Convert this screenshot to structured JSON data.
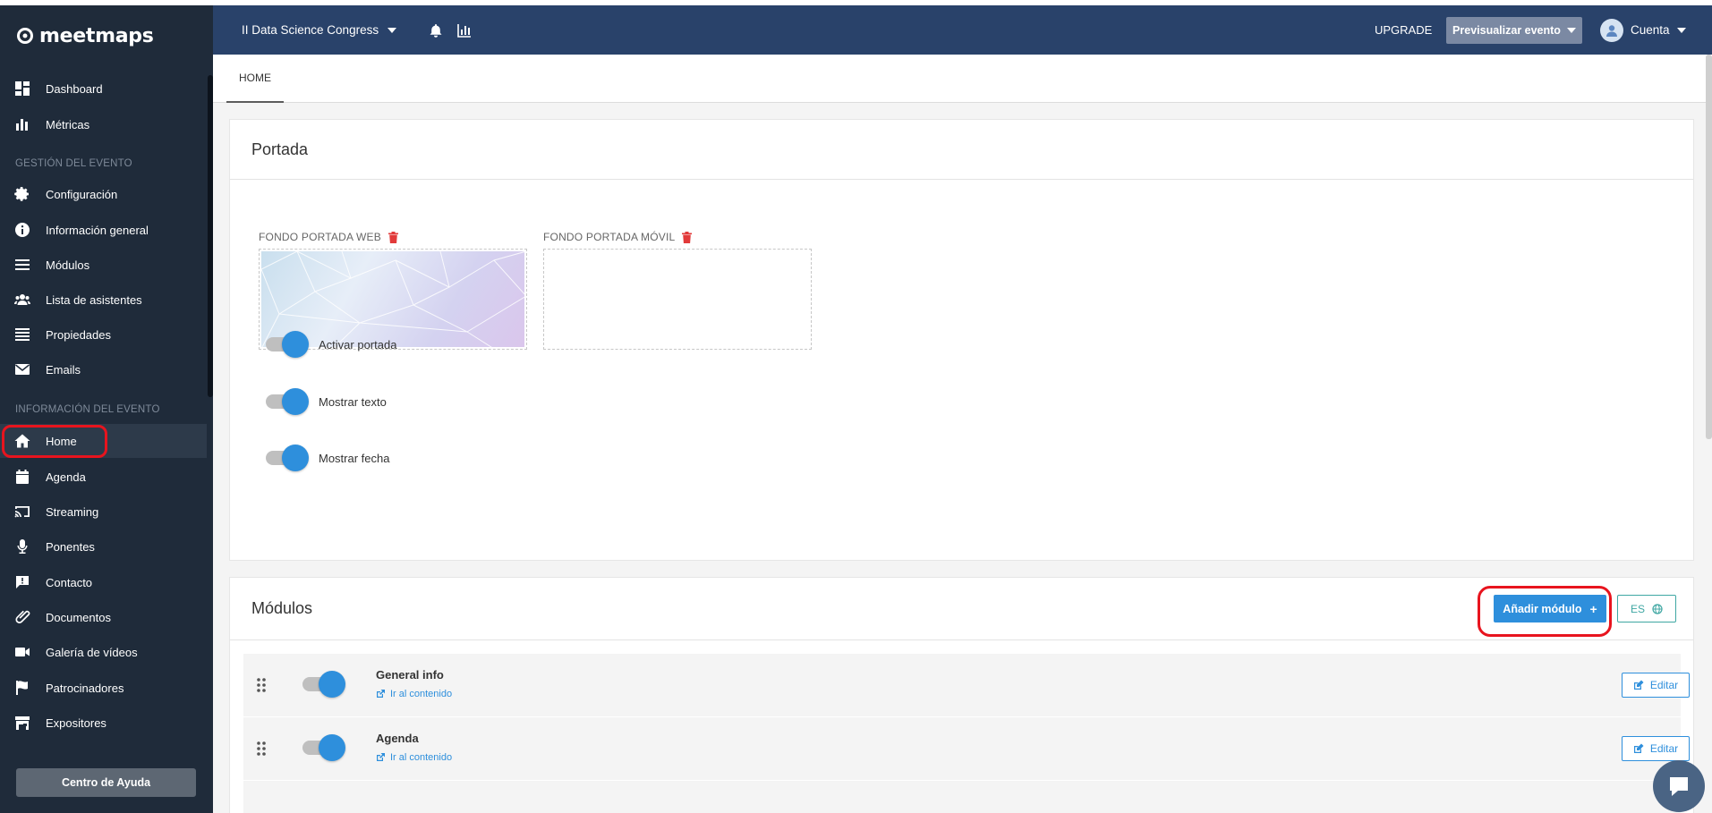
{
  "brand": {
    "logo_text": "meetmaps"
  },
  "sidebar": {
    "items_top": [
      {
        "label": "Dashboard",
        "icon": "dashboard-icon"
      },
      {
        "label": "Métricas",
        "icon": "bar-chart-icon"
      }
    ],
    "section_gestion": "GESTIÓN DEL EVENTO",
    "items_gestion": [
      {
        "label": "Configuración",
        "icon": "gear-icon"
      },
      {
        "label": "Información general",
        "icon": "info-icon"
      },
      {
        "label": "Módulos",
        "icon": "menu-icon"
      },
      {
        "label": "Lista de asistentes",
        "icon": "users-icon"
      },
      {
        "label": "Propiedades",
        "icon": "list-icon"
      },
      {
        "label": "Emails",
        "icon": "mail-icon"
      }
    ],
    "section_info": "INFORMACIÓN DEL EVENTO",
    "items_info": [
      {
        "label": "Home",
        "icon": "home-icon",
        "active": true
      },
      {
        "label": "Agenda",
        "icon": "calendar-icon"
      },
      {
        "label": "Streaming",
        "icon": "cast-icon"
      },
      {
        "label": "Ponentes",
        "icon": "microphone-icon"
      },
      {
        "label": "Contacto",
        "icon": "message-icon"
      },
      {
        "label": "Documentos",
        "icon": "paperclip-icon"
      },
      {
        "label": "Galería de vídeos",
        "icon": "video-icon"
      },
      {
        "label": "Patrocinadores",
        "icon": "flag-icon"
      },
      {
        "label": "Expositores",
        "icon": "store-icon"
      }
    ],
    "help_button": "Centro de Ayuda"
  },
  "topbar": {
    "event_name": "II Data Science Congress",
    "upgrade": "UPGRADE",
    "preview_button": "Previsualizar evento",
    "account": "Cuenta"
  },
  "tabs": [
    {
      "label": "HOME",
      "active": true
    }
  ],
  "portada": {
    "title": "Portada",
    "web_label": "FONDO PORTADA WEB",
    "mobile_label": "FONDO PORTADA MÓVIL",
    "toggles": [
      {
        "label": "Activar portada",
        "on": true
      },
      {
        "label": "Mostrar texto",
        "on": true
      },
      {
        "label": "Mostrar fecha",
        "on": true
      }
    ]
  },
  "modulos": {
    "title": "Módulos",
    "add_button": "Añadir módulo",
    "lang_button": "ES",
    "rows": [
      {
        "name": "General info",
        "link": "Ir al contenido",
        "edit": "Editar",
        "on": true
      },
      {
        "name": "Agenda",
        "link": "Ir al contenido",
        "edit": "Editar",
        "on": true
      }
    ]
  },
  "colors": {
    "sidebar_bg": "#1f2b3a",
    "topbar_bg": "#29426a",
    "accent": "#2e8fdc",
    "highlight": "#e8141e"
  }
}
